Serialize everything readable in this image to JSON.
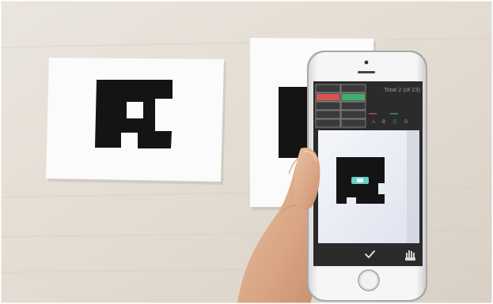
{
  "phone_app": {
    "counter_text": "Total 2 (of 23)",
    "vote_letters": [
      "A",
      "B",
      "C",
      "D"
    ],
    "confirm_icon": "checkmark-icon",
    "menu_icon": "hand-gesture-icon",
    "colors": {
      "red_bar": "#d9534f",
      "green_bar": "#3fae6f",
      "marker_highlight": "#63d2c8"
    }
  }
}
